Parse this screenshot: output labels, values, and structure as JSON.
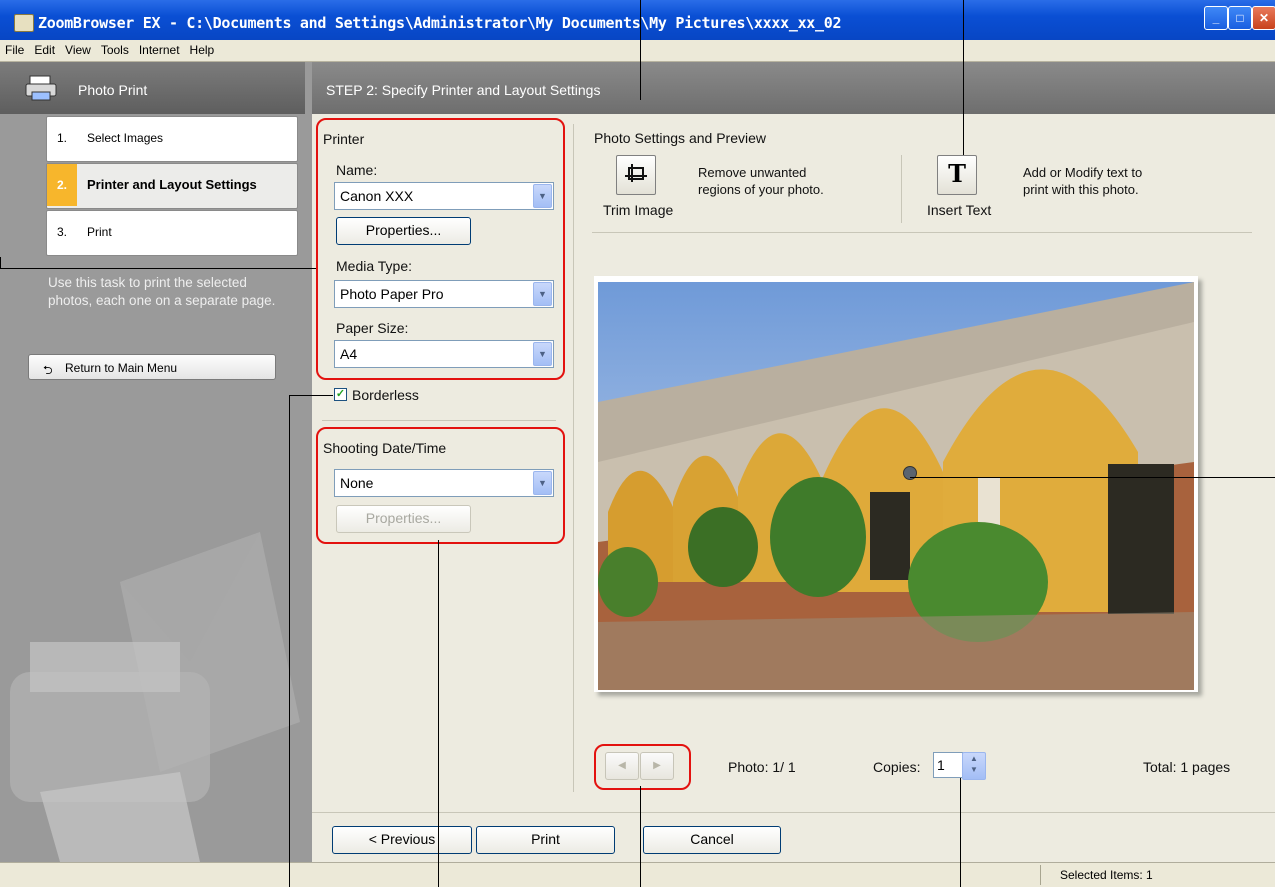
{
  "window": {
    "title": "ZoomBrowser EX  -  C:\\Documents and Settings\\Administrator\\My Documents\\My Pictures\\xxxx_xx_02"
  },
  "menu": [
    "File",
    "Edit",
    "View",
    "Tools",
    "Internet",
    "Help"
  ],
  "left_panel": {
    "header": "Photo Print",
    "steps": [
      {
        "num": "1.",
        "label": "Select Images"
      },
      {
        "num": "2.",
        "label": "Printer and Layout Settings"
      },
      {
        "num": "3.",
        "label": "Print"
      }
    ],
    "description": "Use this task to print the selected photos, each one on a separate page.",
    "return_button": "Return to Main Menu"
  },
  "step_header": "STEP 2: Specify Printer and Layout Settings",
  "printer": {
    "section_title": "Printer",
    "name_label": "Name:",
    "name_value": "Canon XXX",
    "properties_button": "Properties...",
    "media_label": "Media Type:",
    "media_value": "Photo Paper Pro",
    "paper_label": "Paper Size:",
    "paper_value": "A4",
    "borderless_label": "Borderless",
    "borderless_checked": true
  },
  "shooting": {
    "title": "Shooting Date/Time",
    "value": "None",
    "properties_button": "Properties..."
  },
  "preview": {
    "title": "Photo Settings and Preview",
    "trim_label": "Trim Image",
    "trim_desc_1": "Remove unwanted",
    "trim_desc_2": "regions of your photo.",
    "text_label": "Insert Text",
    "text_desc_1": "Add or Modify text to",
    "text_desc_2": "print with this photo.",
    "photo_counter": "Photo: 1/ 1",
    "copies_label": "Copies:",
    "copies_value": "1",
    "total": "Total: 1 pages"
  },
  "bottom_buttons": {
    "previous": "< Previous",
    "print": "Print",
    "cancel": "Cancel"
  },
  "status_bar": {
    "selected": "Selected Items: 1"
  },
  "colors": {
    "title_bar": "#0a4fd4",
    "active_step": "#f7b62c",
    "callout_box": "#e3120f"
  }
}
